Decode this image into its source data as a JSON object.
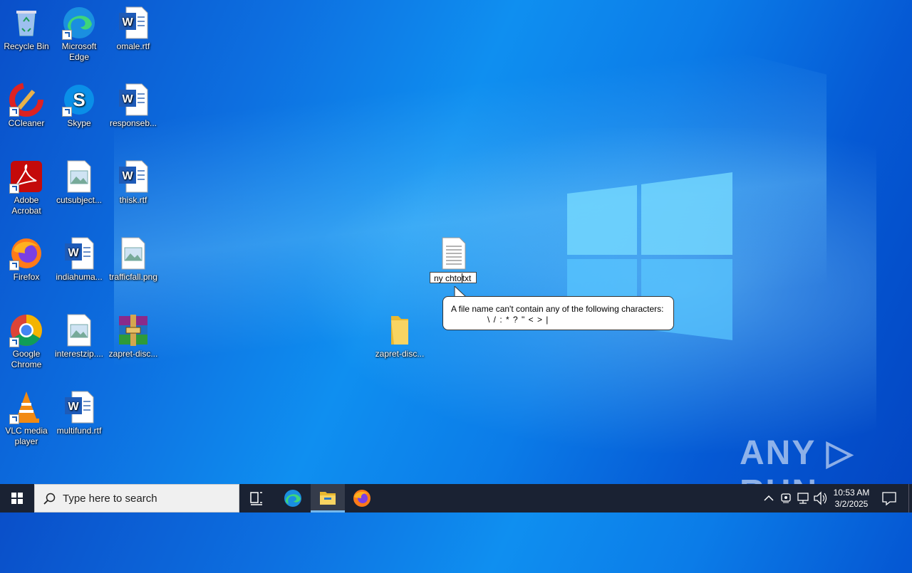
{
  "desktop": {
    "icons": [
      {
        "label": "Recycle Bin"
      },
      {
        "label": "Microsoft Edge"
      },
      {
        "label": "omale.rtf"
      },
      {
        "label": "CCleaner"
      },
      {
        "label": "Skype"
      },
      {
        "label": "responseb..."
      },
      {
        "label": "Adobe Acrobat"
      },
      {
        "label": "cutsubject..."
      },
      {
        "label": "thisk.rtf"
      },
      {
        "label": "Firefox"
      },
      {
        "label": "indiahuma..."
      },
      {
        "label": "trafficfall.png"
      },
      {
        "label": "Google Chrome"
      },
      {
        "label": "interestzip...."
      },
      {
        "label": "zapret-disc..."
      },
      {
        "label": "VLC media player"
      },
      {
        "label": "multifund.rtf"
      },
      {
        "label": "zapret-disc..."
      }
    ],
    "rename": {
      "before_caret": "ny chto",
      "after_caret": "txt"
    },
    "tooltip": {
      "line1": "A file name can't contain any of the following characters:",
      "line2": "\\ / : * ? \" < > |"
    },
    "watermark": "ANY ▷ RUN"
  },
  "taskbar": {
    "search_placeholder": "Type here to search",
    "clock_time": "10:53 AM",
    "clock_date": "3/2/2025"
  },
  "colors": {
    "taskbar": "#1a2233",
    "wallpaper_primary": "#0b7ce8"
  }
}
